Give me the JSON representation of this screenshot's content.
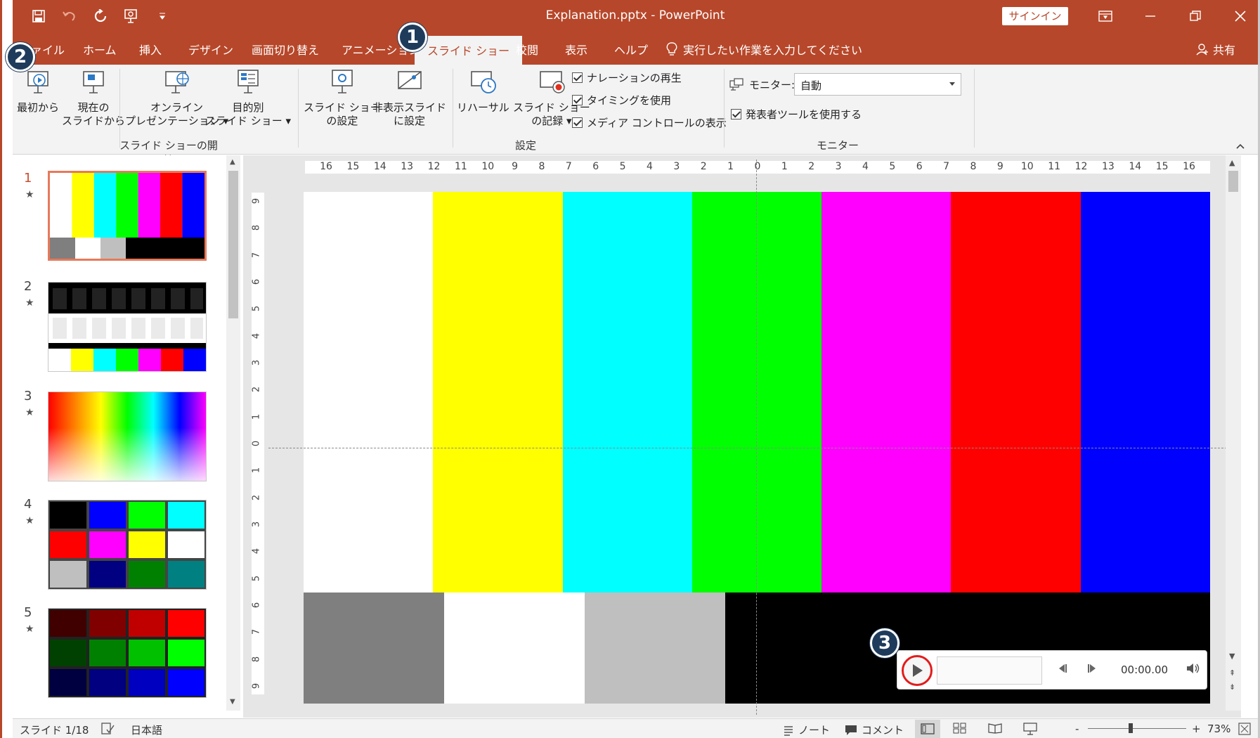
{
  "titlebar": {
    "title": "Explanation.pptx  -  PowerPoint",
    "signin": "サインイン",
    "bg_color": "#b7472a"
  },
  "tabs": [
    {
      "label": "ファイル"
    },
    {
      "label": "ホーム"
    },
    {
      "label": "挿入"
    },
    {
      "label": "デザイン"
    },
    {
      "label": "画面切り替え"
    },
    {
      "label": "アニメーション"
    },
    {
      "label": "スライド ショー",
      "active": true
    },
    {
      "label": "校閲"
    },
    {
      "label": "表示"
    },
    {
      "label": "ヘルプ"
    }
  ],
  "tellme": "実行したい作業を入力してください",
  "share": "共有",
  "ribbon": {
    "start": {
      "from_beginning": [
        "最初から"
      ],
      "from_current": [
        "現在の",
        "スライドから"
      ],
      "online": [
        "オンライン",
        "プレゼンテーション ▾"
      ],
      "custom": [
        "目的別",
        "スライド ショー ▾"
      ],
      "group_label": "スライド ショーの開始"
    },
    "setup": {
      "setup_show": [
        "スライド ショー",
        "の設定"
      ],
      "hide_slide": [
        "非表示スライド",
        "に設定"
      ],
      "rehearse": [
        "リハーサル"
      ],
      "record": [
        "スライド ショー",
        "の記録 ▾"
      ],
      "play_narration": "ナレーションの再生",
      "use_timings": "タイミングを使用",
      "show_media_controls": "メディア コントロールの表示",
      "group_label": "設定"
    },
    "monitor": {
      "label": "モニター:",
      "value": "自動",
      "presenter_view": "発表者ツールを使用する",
      "group_label": "モニター"
    }
  },
  "thumbnails": [
    {
      "num": "1",
      "star": "★"
    },
    {
      "num": "2",
      "star": "★"
    },
    {
      "num": "3",
      "star": "★"
    },
    {
      "num": "4",
      "star": "★"
    },
    {
      "num": "5",
      "star": "★"
    }
  ],
  "slide": {
    "top_bars": [
      "#ffffff",
      "#ffff00",
      "#00ffff",
      "#00ff00",
      "#ff00ff",
      "#ff0000",
      "#0000ff"
    ],
    "bottom_bars": [
      "#7f7f7f",
      "#ffffff",
      "#bfbfbf",
      "#000000"
    ]
  },
  "media": {
    "time": "00:00.00"
  },
  "ruler": {
    "horizontal": [
      "16",
      "15",
      "14",
      "13",
      "12",
      "11",
      "10",
      "9",
      "8",
      "7",
      "6",
      "5",
      "4",
      "3",
      "2",
      "1",
      "0",
      "1",
      "2",
      "3",
      "4",
      "5",
      "6",
      "7",
      "8",
      "9",
      "10",
      "11",
      "12",
      "13",
      "14",
      "15",
      "16"
    ],
    "vertical": [
      "9",
      "8",
      "7",
      "6",
      "5",
      "4",
      "3",
      "2",
      "1",
      "0",
      "1",
      "2",
      "3",
      "4",
      "5",
      "6",
      "7",
      "8",
      "9"
    ]
  },
  "badges": [
    "1",
    "2",
    "3"
  ],
  "statusbar": {
    "slide_counter": "スライド 1/18",
    "language": "日本語",
    "notes": "ノート",
    "comments": "コメント",
    "zoom_minus": "-",
    "zoom_plus": "+",
    "zoom": "73%"
  }
}
